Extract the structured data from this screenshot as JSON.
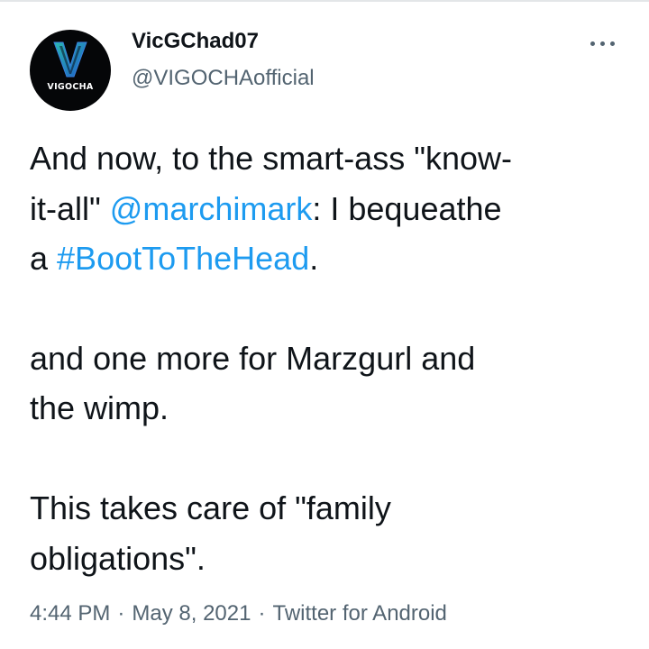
{
  "tweet": {
    "avatar_text": "VIGOCHA",
    "display_name": "VicGChad07",
    "handle": "@VIGOCHAofficial",
    "text": {
      "p1_a": "And now, to the smart-ass \"know-",
      "p1_b": "it-all\" ",
      "mention": "@marchimark",
      "p1_c": ": I bequeathe",
      "p1_d": "a ",
      "hashtag": "#BootToTheHead",
      "p1_e": ".",
      "p2_a": "and one more for Marzgurl and",
      "p2_b": "the wimp.",
      "p3_a": "This takes care of \"family",
      "p3_b": "obligations\"."
    },
    "time": "4:44 PM",
    "date": "May 8, 2021",
    "separator": "·",
    "source": "Twitter for Android"
  },
  "icons": {
    "more": "more-horizontal-icon",
    "avatar_logo": "v-logo-icon"
  },
  "colors": {
    "link": "#1d9bf0",
    "muted": "#536471",
    "text": "#0f1419",
    "avatar_bg": "#050608",
    "logo_blue": "#1e5ec9",
    "logo_teal": "#2ab7b0"
  }
}
